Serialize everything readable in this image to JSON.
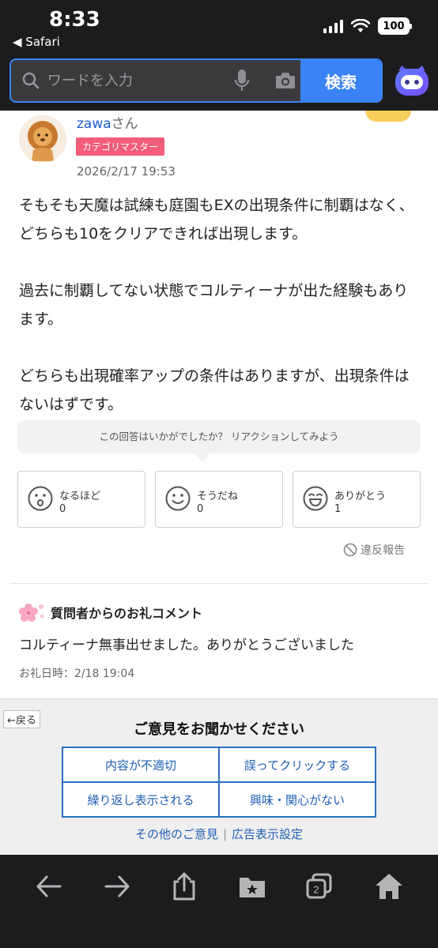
{
  "status": {
    "time": "8:33",
    "back_app": "◀ Safari",
    "battery": "100"
  },
  "search": {
    "placeholder": "ワードを入力",
    "button_label": "検索"
  },
  "answer": {
    "username": "zawa",
    "honorific": "さん",
    "badge": "カテゴリマスター",
    "date": "2026/2/17 19:53",
    "paragraphs": [
      "そもそも天魔は試練も庭園もEXの出現条件に制覇はなく、どちらも10をクリアできれば出現します。",
      "過去に制覇してない状態でコルティーナが出た経験もあります。",
      "どちらも出現確率アップの条件はありますが、出現条件はないはずです。"
    ]
  },
  "reactions": {
    "prompt": "この回答はいかがでしたか？ リアクションしてみよう",
    "items": [
      {
        "label": "なるほど",
        "count": "0"
      },
      {
        "label": "そうだね",
        "count": "0"
      },
      {
        "label": "ありがとう",
        "count": "1"
      }
    ]
  },
  "report_label": "違反報告",
  "thanks": {
    "heading": "質問者からのお礼コメント",
    "body": "コルティーナ無事出せました。ありがとうございました",
    "date": "お礼日時：2/18 19:04"
  },
  "ad_feedback": {
    "back": "←戻る",
    "title": "ご意見をお聞かせください",
    "options": [
      "内容が不適切",
      "誤ってクリックする",
      "繰り返し表示される",
      "興味・関心がない"
    ],
    "other": "その他のご意見",
    "settings": "広告表示設定"
  },
  "toolbar": {
    "tab_count": "2"
  },
  "colors": {
    "accent": "#3a83f6",
    "badge": "#f25d7a",
    "link": "#1f5fb6"
  }
}
